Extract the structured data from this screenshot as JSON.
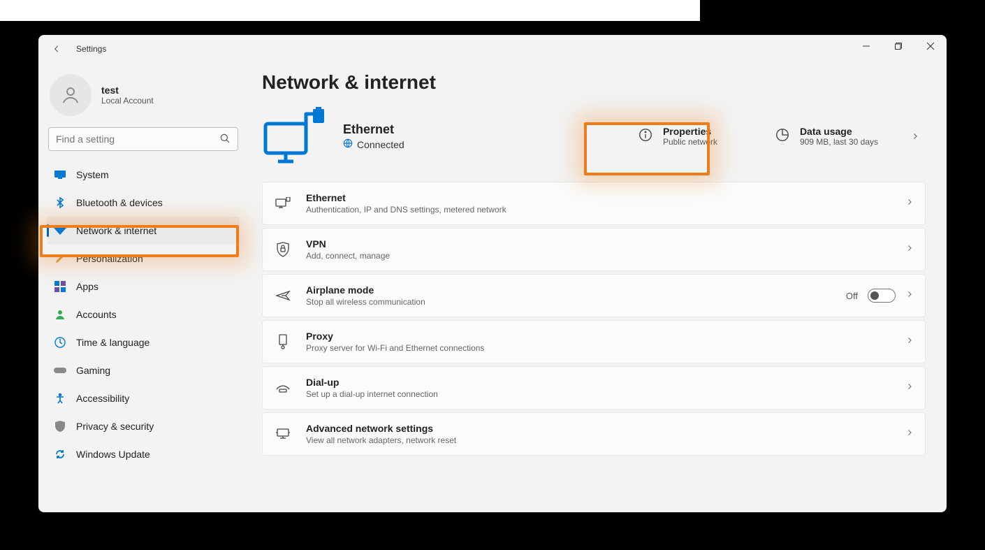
{
  "window": {
    "title": "Settings"
  },
  "user": {
    "name": "test",
    "sub": "Local Account"
  },
  "search": {
    "placeholder": "Find a setting"
  },
  "nav": {
    "items": [
      {
        "label": "System"
      },
      {
        "label": "Bluetooth & devices"
      },
      {
        "label": "Network & internet"
      },
      {
        "label": "Personalization"
      },
      {
        "label": "Apps"
      },
      {
        "label": "Accounts"
      },
      {
        "label": "Time & language"
      },
      {
        "label": "Gaming"
      },
      {
        "label": "Accessibility"
      },
      {
        "label": "Privacy & security"
      },
      {
        "label": "Windows Update"
      }
    ]
  },
  "page": {
    "title": "Network & internet"
  },
  "hero": {
    "title": "Ethernet",
    "status": "Connected",
    "properties": {
      "title": "Properties",
      "sub": "Public network"
    },
    "usage": {
      "title": "Data usage",
      "sub": "909 MB, last 30 days"
    }
  },
  "rows": [
    {
      "title": "Ethernet",
      "sub": "Authentication, IP and DNS settings, metered network"
    },
    {
      "title": "VPN",
      "sub": "Add, connect, manage"
    },
    {
      "title": "Airplane mode",
      "sub": "Stop all wireless communication",
      "toggle_label": "Off"
    },
    {
      "title": "Proxy",
      "sub": "Proxy server for Wi-Fi and Ethernet connections"
    },
    {
      "title": "Dial-up",
      "sub": "Set up a dial-up internet connection"
    },
    {
      "title": "Advanced network settings",
      "sub": "View all network adapters, network reset"
    }
  ]
}
